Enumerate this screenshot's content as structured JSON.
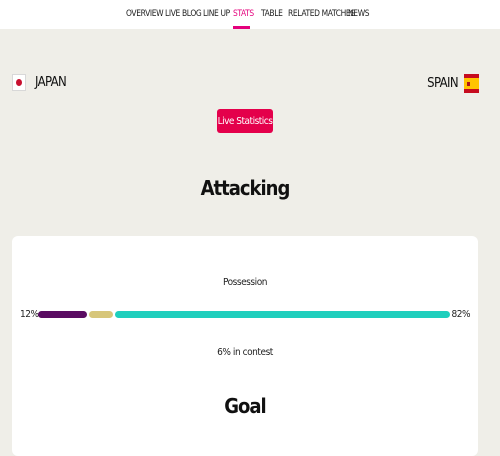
{
  "nav": {
    "items": [
      {
        "label": "OVERVIEW"
      },
      {
        "label": "LIVE BLOG"
      },
      {
        "label": "LINE UP"
      },
      {
        "label": "STATS"
      },
      {
        "label": "TABLE"
      },
      {
        "label": "RELATED MATCHES"
      },
      {
        "label": "NEWS"
      }
    ],
    "active": "STATS"
  },
  "match": {
    "home": {
      "name": "JAPAN",
      "flag_icon": "japan-flag-icon"
    },
    "away": {
      "name": "SPAIN",
      "flag_icon": "spain-flag-icon"
    }
  },
  "live_badge": "Live Statistics",
  "sections": {
    "attacking": "Attacking",
    "goal": "Goal"
  },
  "possession": {
    "label": "Possession",
    "home_pct": "12%",
    "away_pct": "82%",
    "contest_label": "6% in contest",
    "home_value": 12,
    "contest_value": 6,
    "away_value": 82,
    "colors": {
      "home": "#5a0b62",
      "contest": "#d7c67a",
      "away": "#1fcfbd"
    }
  },
  "colors": {
    "accent": "#e4007c",
    "badge": "#e4004b",
    "background": "#efeee8"
  }
}
